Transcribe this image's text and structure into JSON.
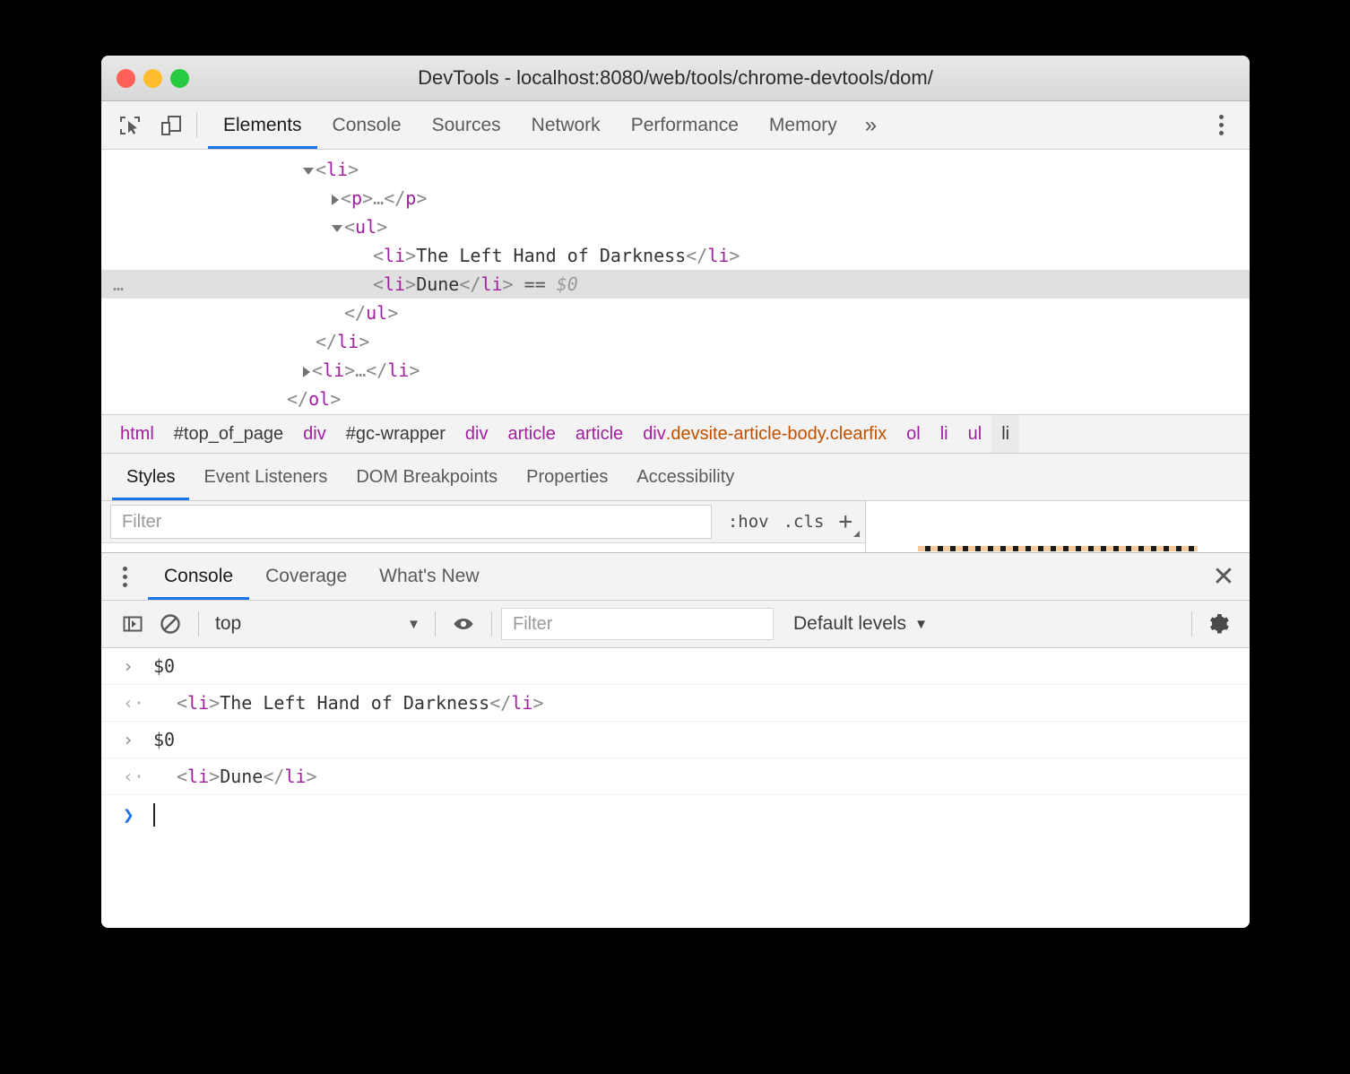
{
  "window": {
    "title": "DevTools - localhost:8080/web/tools/chrome-devtools/dom/",
    "traffic_lights": [
      "close",
      "minimize",
      "maximize"
    ]
  },
  "main_toolbar": {
    "icons": [
      "inspect-element-icon",
      "device-toolbar-icon"
    ],
    "tabs": [
      {
        "label": "Elements",
        "active": true
      },
      {
        "label": "Console",
        "active": false
      },
      {
        "label": "Sources",
        "active": false
      },
      {
        "label": "Network",
        "active": false
      },
      {
        "label": "Performance",
        "active": false
      },
      {
        "label": "Memory",
        "active": false
      }
    ],
    "overflow_label": "»",
    "more_label": "more-options"
  },
  "dom_tree": {
    "rows": [
      {
        "indent": 0,
        "twisty": "down",
        "parts": [
          {
            "t": "punc",
            "v": "<"
          },
          {
            "t": "tag",
            "v": "li"
          },
          {
            "t": "punc",
            "v": ">"
          }
        ],
        "selected": false
      },
      {
        "indent": 1,
        "twisty": "right",
        "parts": [
          {
            "t": "punc",
            "v": "<"
          },
          {
            "t": "tag",
            "v": "p"
          },
          {
            "t": "punc",
            "v": ">"
          },
          {
            "t": "dots",
            "v": "…"
          },
          {
            "t": "punc",
            "v": "</"
          },
          {
            "t": "tag",
            "v": "p"
          },
          {
            "t": "punc",
            "v": ">"
          }
        ],
        "selected": false
      },
      {
        "indent": 1,
        "twisty": "down",
        "parts": [
          {
            "t": "punc",
            "v": "<"
          },
          {
            "t": "tag",
            "v": "ul"
          },
          {
            "t": "punc",
            "v": ">"
          }
        ],
        "selected": false
      },
      {
        "indent": 2,
        "twisty": "none",
        "parts": [
          {
            "t": "punc",
            "v": "<"
          },
          {
            "t": "tag",
            "v": "li"
          },
          {
            "t": "punc",
            "v": ">"
          },
          {
            "t": "txt",
            "v": "The Left Hand of Darkness"
          },
          {
            "t": "punc",
            "v": "</"
          },
          {
            "t": "tag",
            "v": "li"
          },
          {
            "t": "punc",
            "v": ">"
          }
        ],
        "selected": false
      },
      {
        "indent": 2,
        "twisty": "none",
        "parts": [
          {
            "t": "punc",
            "v": "<"
          },
          {
            "t": "tag",
            "v": "li"
          },
          {
            "t": "punc",
            "v": ">"
          },
          {
            "t": "txt",
            "v": "Dune"
          },
          {
            "t": "punc",
            "v": "</"
          },
          {
            "t": "tag",
            "v": "li"
          },
          {
            "t": "punc",
            "v": ">"
          },
          {
            "t": "eq",
            "v": " == "
          },
          {
            "t": "dollar",
            "v": "$0"
          }
        ],
        "selected": true,
        "badge": "…"
      },
      {
        "indent": 1,
        "twisty": "none",
        "parts": [
          {
            "t": "punc",
            "v": "</"
          },
          {
            "t": "tag",
            "v": "ul"
          },
          {
            "t": "punc",
            "v": ">"
          }
        ],
        "selected": false
      },
      {
        "indent": 0,
        "twisty": "none",
        "parts": [
          {
            "t": "punc",
            "v": "</"
          },
          {
            "t": "tag",
            "v": "li"
          },
          {
            "t": "punc",
            "v": ">"
          }
        ],
        "selected": false
      },
      {
        "indent": 0,
        "twisty": "right",
        "parts": [
          {
            "t": "punc",
            "v": "<"
          },
          {
            "t": "tag",
            "v": "li"
          },
          {
            "t": "punc",
            "v": ">"
          },
          {
            "t": "dots",
            "v": "…"
          },
          {
            "t": "punc",
            "v": "</"
          },
          {
            "t": "tag",
            "v": "li"
          },
          {
            "t": "punc",
            "v": ">"
          }
        ],
        "selected": false
      },
      {
        "indent": -1,
        "twisty": "none",
        "parts": [
          {
            "t": "punc",
            "v": "</"
          },
          {
            "t": "tag",
            "v": "ol"
          },
          {
            "t": "punc",
            "v": ">"
          }
        ],
        "selected": false
      }
    ]
  },
  "breadcrumb": {
    "items": [
      {
        "name": "html",
        "cls": "",
        "kind": "tag",
        "selected": false
      },
      {
        "name": "#top_of_page",
        "cls": "",
        "kind": "id",
        "selected": false
      },
      {
        "name": "div",
        "cls": "",
        "kind": "tag",
        "selected": false
      },
      {
        "name": "#gc-wrapper",
        "cls": "",
        "kind": "id",
        "selected": false
      },
      {
        "name": "div",
        "cls": "",
        "kind": "tag",
        "selected": false
      },
      {
        "name": "article",
        "cls": "",
        "kind": "tag",
        "selected": false
      },
      {
        "name": "article",
        "cls": "",
        "kind": "tag",
        "selected": false
      },
      {
        "name": "div",
        "cls": ".devsite-article-body.clearfix",
        "kind": "tag",
        "selected": false
      },
      {
        "name": "ol",
        "cls": "",
        "kind": "tag",
        "selected": false
      },
      {
        "name": "li",
        "cls": "",
        "kind": "tag",
        "selected": false
      },
      {
        "name": "ul",
        "cls": "",
        "kind": "tag",
        "selected": false
      },
      {
        "name": "li",
        "cls": "",
        "kind": "tag",
        "selected": true
      }
    ]
  },
  "sidebar_tabs": {
    "tabs": [
      {
        "label": "Styles",
        "active": true
      },
      {
        "label": "Event Listeners",
        "active": false
      },
      {
        "label": "DOM Breakpoints",
        "active": false
      },
      {
        "label": "Properties",
        "active": false
      },
      {
        "label": "Accessibility",
        "active": false
      }
    ]
  },
  "styles_pane": {
    "filter_placeholder": "Filter",
    "hov_label": ":hov",
    "cls_label": ".cls",
    "new_rule_label": "+"
  },
  "drawer": {
    "menu_label": "drawer-menu",
    "tabs": [
      {
        "label": "Console",
        "active": true
      },
      {
        "label": "Coverage",
        "active": false
      },
      {
        "label": "What's New",
        "active": false
      }
    ],
    "close_label": "✕"
  },
  "console_toolbar": {
    "sidebar_toggle": "console-sidebar-icon",
    "clear_label": "clear-console-icon",
    "context_value": "top",
    "context_caret": "▼",
    "eye_label": "live-expression-icon",
    "filter_placeholder": "Filter",
    "levels_label": "Default levels",
    "levels_caret": "▼",
    "settings_label": "console-settings-icon"
  },
  "console_output": {
    "messages": [
      {
        "kind": "input",
        "gutter": "›",
        "parts": [
          {
            "t": "txt",
            "v": "$0"
          }
        ]
      },
      {
        "kind": "output",
        "gutter": "‹·",
        "parts": [
          {
            "t": "punc",
            "v": "<"
          },
          {
            "t": "tag",
            "v": "li"
          },
          {
            "t": "punc",
            "v": ">"
          },
          {
            "t": "txt",
            "v": "The Left Hand of Darkness"
          },
          {
            "t": "punc",
            "v": "</"
          },
          {
            "t": "tag",
            "v": "li"
          },
          {
            "t": "punc",
            "v": ">"
          }
        ]
      },
      {
        "kind": "input",
        "gutter": "›",
        "parts": [
          {
            "t": "txt",
            "v": "$0"
          }
        ]
      },
      {
        "kind": "output",
        "gutter": "‹·",
        "parts": [
          {
            "t": "punc",
            "v": "<"
          },
          {
            "t": "tag",
            "v": "li"
          },
          {
            "t": "punc",
            "v": ">"
          },
          {
            "t": "txt",
            "v": "Dune"
          },
          {
            "t": "punc",
            "v": "</"
          },
          {
            "t": "tag",
            "v": "li"
          },
          {
            "t": "punc",
            "v": ">"
          }
        ]
      }
    ],
    "prompt_arrow": "❯",
    "prompt_value": ""
  },
  "colors": {
    "accent": "#1a73e8",
    "tag": "#a020a0",
    "class": "#c05000",
    "text": "#333333",
    "punctuation": "#888888",
    "selected_row": "#e0e0e0",
    "toolbar_bg": "#f3f3f3"
  }
}
